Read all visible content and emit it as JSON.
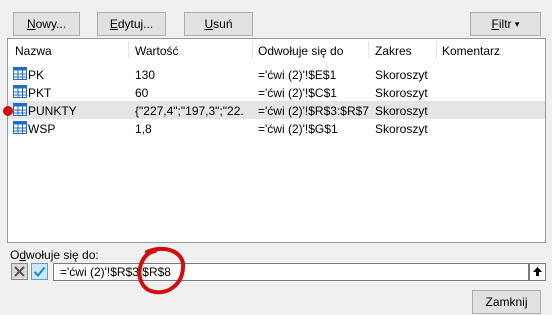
{
  "toolbar": {
    "new_prefix": "N",
    "new_rest": "owy...",
    "edit_prefix": "E",
    "edit_rest": "dytuj...",
    "delete_prefix": "U",
    "delete_rest": "suń",
    "filter_prefix": "F",
    "filter_rest": "iltr",
    "filter_arrow": "▾"
  },
  "columns": {
    "name": "Nazwa",
    "value": "Wartość",
    "refers_to": "Odwołuje się do",
    "scope": "Zakres",
    "comment": "Komentarz"
  },
  "rows": [
    {
      "name": "PK",
      "value": "130",
      "refers_to": "='ćwi (2)'!$E$1",
      "scope": "Skoroszyt",
      "comment": ""
    },
    {
      "name": "PKT",
      "value": "60",
      "refers_to": "='ćwi (2)'!$C$1",
      "scope": "Skoroszyt",
      "comment": ""
    },
    {
      "name": "PUNKTY",
      "value": "{\"227,4\";\"197,3\";\"22...",
      "refers_to": "='ćwi (2)'!$R$3:$R$7",
      "scope": "Skoroszyt",
      "comment": ""
    },
    {
      "name": "WSP",
      "value": "1,8",
      "refers_to": "='ćwi (2)'!$G$1",
      "scope": "Skoroszyt",
      "comment": ""
    }
  ],
  "selected_row": 2,
  "refers_to_field": {
    "label_prefix": "O",
    "label_ul": "d",
    "label_rest": "wołuje się do:",
    "value": "='ćwi (2)'!$R$3:$R$8"
  },
  "footer": {
    "close_label": "Zamknij"
  },
  "colors": {
    "accent": "#0078d7",
    "annotation": "#d10d0d"
  }
}
